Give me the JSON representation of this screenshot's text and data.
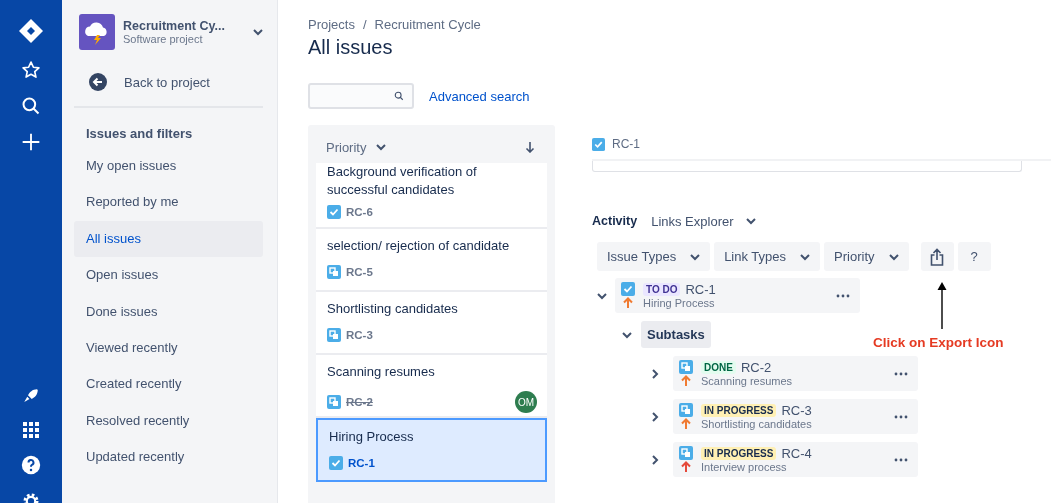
{
  "project": {
    "name": "Recruitment Cy...",
    "type": "Software project"
  },
  "back_link": "Back to project",
  "sidebar": {
    "heading": "Issues and filters",
    "items": [
      {
        "label": "My open issues",
        "selected": false
      },
      {
        "label": "Reported by me",
        "selected": false
      },
      {
        "label": "All issues",
        "selected": true
      },
      {
        "label": "Open issues",
        "selected": false
      },
      {
        "label": "Done issues",
        "selected": false
      },
      {
        "label": "Viewed recently",
        "selected": false
      },
      {
        "label": "Created recently",
        "selected": false
      },
      {
        "label": "Resolved recently",
        "selected": false
      },
      {
        "label": "Updated recently",
        "selected": false
      }
    ]
  },
  "breadcrumbs": [
    "Projects",
    "Recruitment Cycle"
  ],
  "breadcrumb_separator": "/",
  "title": "All issues",
  "advanced_search": "Advanced search",
  "issue_list": {
    "sort": "Priority",
    "items": [
      {
        "summary": "Background verification of successful candidates",
        "key": "RC-6",
        "kind": "task",
        "done": false,
        "selected": false
      },
      {
        "summary": "selection/ rejection of candidate",
        "key": "RC-5",
        "kind": "subtask",
        "done": false,
        "selected": false
      },
      {
        "summary": "Shortlisting candidates",
        "key": "RC-3",
        "kind": "subtask",
        "done": false,
        "selected": false
      },
      {
        "summary": "Scanning resumes",
        "key": "RC-2",
        "kind": "subtask",
        "done": true,
        "selected": false,
        "assignee": "OM"
      },
      {
        "summary": "Hiring Process",
        "key": "RC-1",
        "kind": "task",
        "done": false,
        "selected": true
      }
    ]
  },
  "detail": {
    "key": "RC-1",
    "activity": "Activity",
    "view": "Links Explorer",
    "filters": [
      "Issue Types",
      "Link Types",
      "Priority"
    ],
    "help": "?",
    "root": {
      "kind": "task",
      "status": {
        "label": "TO DO",
        "color": "#403294"
      },
      "key": "RC-1",
      "summary": "Hiring Process",
      "priority": {
        "color": "#f07b32"
      },
      "expanded": true
    },
    "group": {
      "label": "Subtasks",
      "expanded": true
    },
    "children": [
      {
        "kind": "subtask",
        "status": {
          "label": "DONE",
          "color": "#006644"
        },
        "key": "RC-2",
        "summary": "Scanning resumes",
        "priority": {
          "color": "#f07b32"
        },
        "expanded": false
      },
      {
        "kind": "subtask",
        "status": {
          "label": "IN PROGRESS",
          "color": "#172b4d"
        },
        "key": "RC-3",
        "summary": "Shortlisting candidates",
        "priority": {
          "color": "#f07b32"
        },
        "expanded": false
      },
      {
        "kind": "subtask",
        "status": {
          "label": "IN PROGRESS",
          "color": "#172b4d"
        },
        "key": "RC-4",
        "summary": "Interview process",
        "priority": {
          "color": "#e5493a"
        },
        "expanded": false
      }
    ]
  },
  "annotation": "Click on Export Icon"
}
